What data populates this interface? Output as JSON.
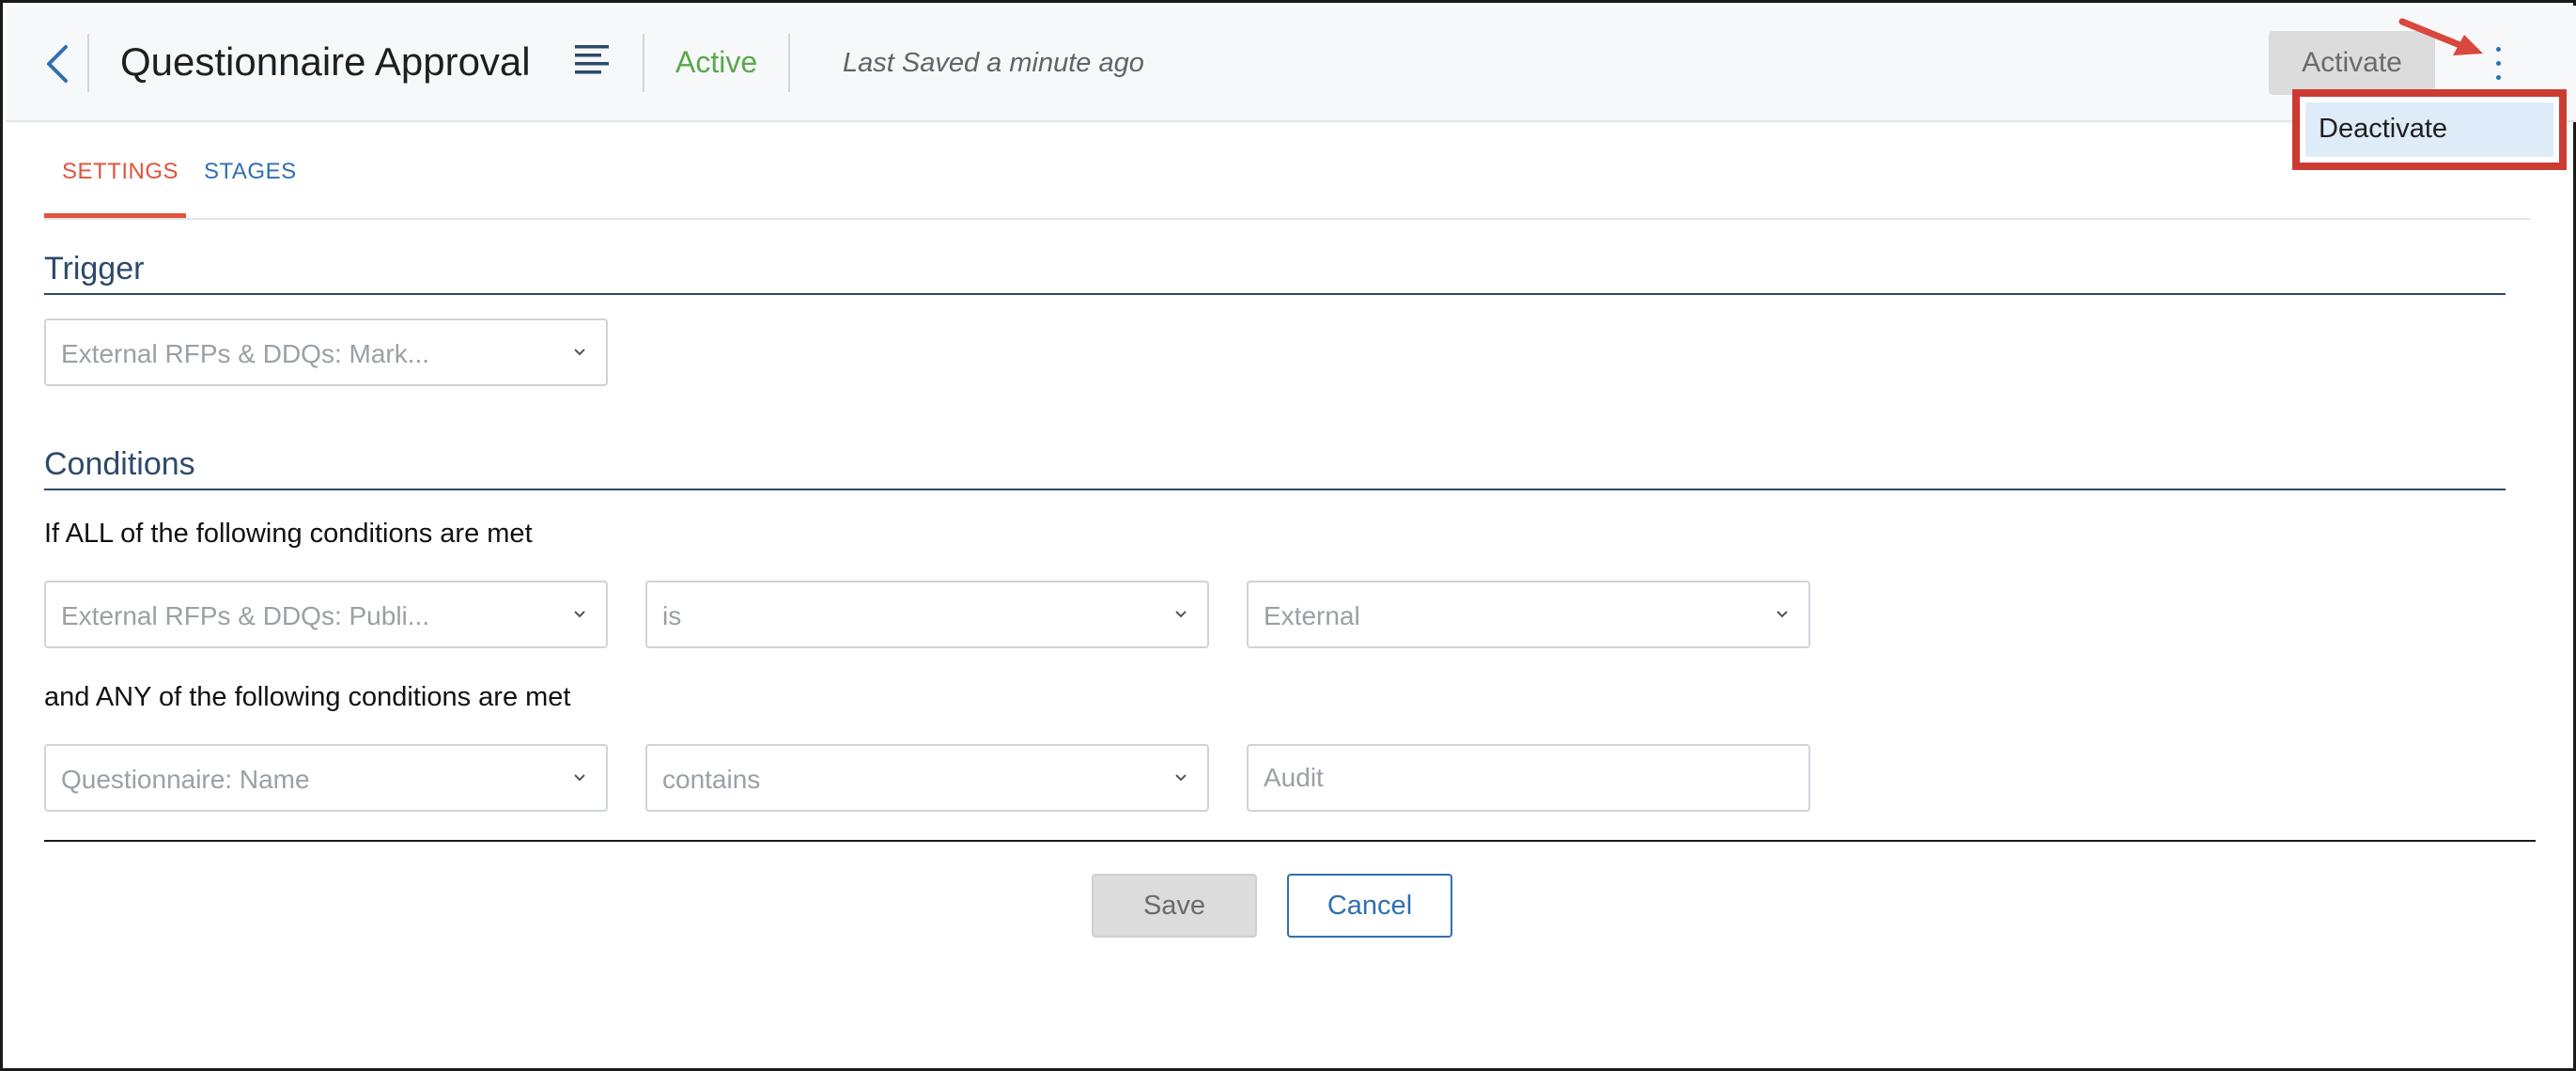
{
  "header": {
    "title": "Questionnaire Approval",
    "status": "Active",
    "last_saved": "Last Saved a minute ago",
    "activate_label": "Activate",
    "back_icon": "chevron-left-icon",
    "title_icon": "align-left-icon",
    "more_icon": "vertical-ellipsis-icon"
  },
  "menu": {
    "items": [
      {
        "label": "Deactivate"
      }
    ]
  },
  "tabs": [
    {
      "label": "SETTINGS",
      "active": true
    },
    {
      "label": "STAGES",
      "active": false
    }
  ],
  "trigger": {
    "heading": "Trigger",
    "select_value": "External RFPs & DDQs: Mark..."
  },
  "conditions": {
    "heading": "Conditions",
    "all_label": "If ALL of the following conditions are met",
    "all_row": {
      "field": "External RFPs & DDQs: Publi...",
      "operator": "is",
      "value": "External"
    },
    "any_label": "and ANY of the following conditions are met",
    "any_row": {
      "field": "Questionnaire: Name",
      "operator": "contains",
      "value_placeholder": "Audit"
    }
  },
  "footer": {
    "save_label": "Save",
    "cancel_label": "Cancel"
  },
  "colors": {
    "accent_blue": "#2f6fb3",
    "active_tab": "#e2533a",
    "status_green": "#5aa84a",
    "highlight_red": "#cc3b32",
    "section_heading": "#2d4a6b"
  }
}
